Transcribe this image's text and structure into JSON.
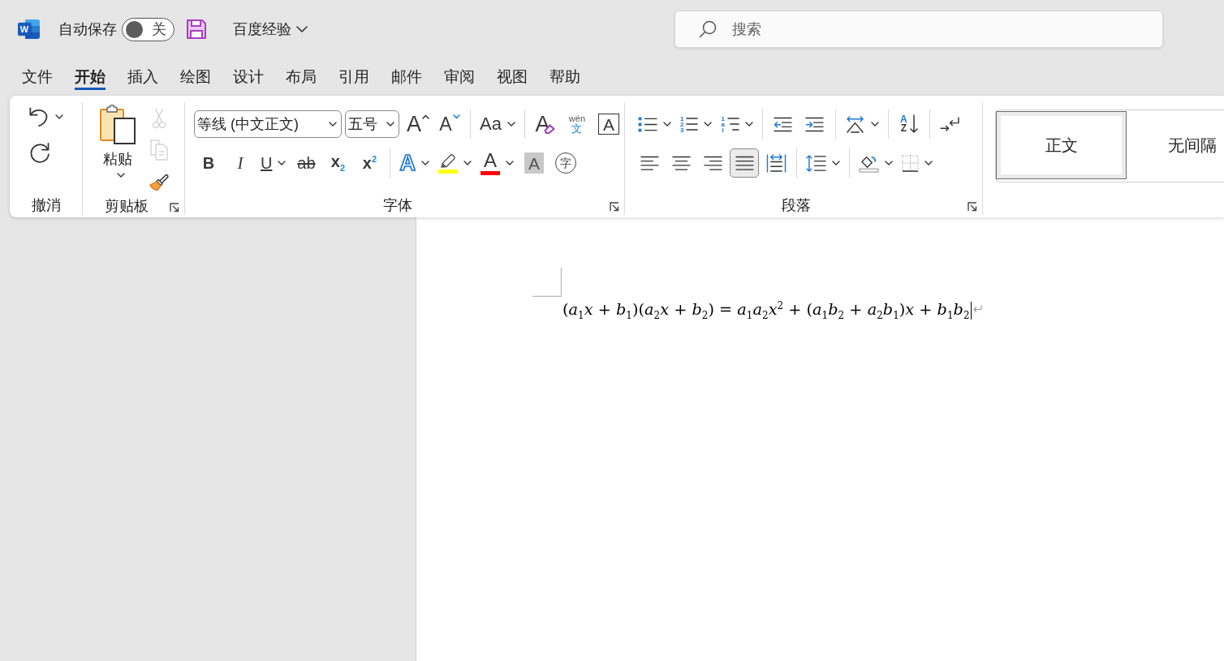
{
  "title_bar": {
    "app_logo": "W",
    "autosave": {
      "label": "自动保存",
      "on": false,
      "toggle_text": "关"
    },
    "document_name": "百度经验",
    "search": {
      "placeholder": "搜索"
    }
  },
  "tabs": [
    {
      "label": "文件",
      "selected": false
    },
    {
      "label": "开始",
      "selected": true
    },
    {
      "label": "插入",
      "selected": false
    },
    {
      "label": "绘图",
      "selected": false
    },
    {
      "label": "设计",
      "selected": false
    },
    {
      "label": "布局",
      "selected": false
    },
    {
      "label": "引用",
      "selected": false
    },
    {
      "label": "邮件",
      "selected": false
    },
    {
      "label": "审阅",
      "selected": false
    },
    {
      "label": "视图",
      "selected": false
    },
    {
      "label": "帮助",
      "selected": false
    }
  ],
  "ribbon": {
    "undo": {
      "label": "撤消",
      "buttons": [
        {
          "kind": "undo",
          "dropdown": true
        },
        {
          "kind": "redo"
        }
      ]
    },
    "clipboard": {
      "label": "剪贴板",
      "launcher": true,
      "paste": {
        "label": "粘贴",
        "dropdown": true
      },
      "buttons": [
        {
          "kind": "cut",
          "disabled": true
        },
        {
          "kind": "copy",
          "disabled": true
        },
        {
          "kind": "format-painter",
          "disabled": false
        }
      ]
    },
    "font": {
      "label": "字体",
      "launcher": true,
      "font_name": "等线 (中文正文)",
      "font_size": "五号",
      "top_tools": [
        {
          "kind": "grow",
          "text": "A"
        },
        {
          "kind": "shrink",
          "text": "A"
        },
        {
          "kind": "separator"
        },
        {
          "kind": "change-case",
          "text": "Aa",
          "dropdown": true
        },
        {
          "kind": "separator"
        },
        {
          "kind": "clear-format",
          "text": "A"
        },
        {
          "kind": "phonetic",
          "text": "wén",
          "sub_text": "文"
        },
        {
          "kind": "char-border",
          "text": "A"
        }
      ],
      "bottom_tools": [
        {
          "kind": "bold",
          "text": "B"
        },
        {
          "kind": "italic",
          "text": "I"
        },
        {
          "kind": "underline",
          "text": "U",
          "dropdown": true
        },
        {
          "kind": "strike",
          "text": "ab"
        },
        {
          "kind": "subscript",
          "text": "x$_{2}$"
        },
        {
          "kind": "superscript",
          "text": "x$^{2}$"
        },
        {
          "kind": "separator"
        },
        {
          "kind": "text-effect",
          "text": "A",
          "dropdown": true
        },
        {
          "kind": "highlight",
          "color": "#ffff00",
          "dropdown": true
        },
        {
          "kind": "font-color",
          "text": "A",
          "color": "#ff0000",
          "dropdown": true
        },
        {
          "kind": "char-shading",
          "text": "A"
        },
        {
          "kind": "enclose",
          "text": "字"
        }
      ]
    },
    "paragraph": {
      "label": "段落",
      "launcher": true,
      "top_tools": [
        {
          "kind": "bullets",
          "dropdown": true
        },
        {
          "kind": "numbering",
          "marks": [
            "1",
            "2",
            "3"
          ],
          "dropdown": true
        },
        {
          "kind": "multilevel",
          "marks": [
            "1",
            "a",
            "i"
          ],
          "dropdown": true
        },
        {
          "kind": "separator"
        },
        {
          "kind": "outdent"
        },
        {
          "kind": "indent"
        },
        {
          "kind": "separator"
        },
        {
          "kind": "asian-layout",
          "dropdown": true
        },
        {
          "kind": "separator"
        },
        {
          "kind": "sort",
          "marks": [
            "A",
            "Z"
          ]
        },
        {
          "kind": "separator"
        },
        {
          "kind": "arrows"
        }
      ],
      "bottom_tools": [
        {
          "kind": "align-left",
          "selected": false
        },
        {
          "kind": "align-center",
          "selected": false
        },
        {
          "kind": "align-right",
          "selected": false
        },
        {
          "kind": "justify",
          "selected": true
        },
        {
          "kind": "distribute",
          "selected": false
        },
        {
          "kind": "separator"
        },
        {
          "kind": "line-spacing",
          "dropdown": true
        },
        {
          "kind": "separator"
        },
        {
          "kind": "shading",
          "dropdown": true
        },
        {
          "kind": "borders",
          "dropdown": true
        }
      ]
    },
    "styles": [
      {
        "label": "正文",
        "selected": true
      },
      {
        "label": "无间隔",
        "selected": false
      }
    ]
  },
  "document": {
    "equation": "(*a*$_{1}$*x* + *b*$_{1}$)(*a*$_{2}$*x* + *b*$_{2}$) = *a*$_{1}$*a*$_{2}$*x*$^{2}$ + (*a*$_{1}$*b*$_{2}$ + *a*$_{2}$*b*$_{1}$)*x* + *b*$_{1}$*b*$_{2}$",
    "cursor": true,
    "paragraph_mark": true
  }
}
